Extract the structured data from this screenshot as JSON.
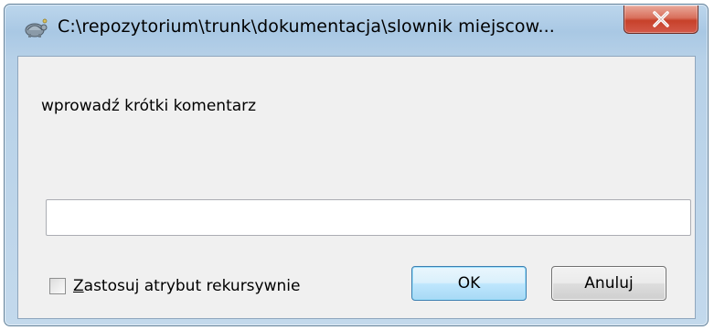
{
  "window": {
    "title": "C:\\repozytorium\\trunk\\dokumentacja\\slownik miejscow...",
    "app_icon": "tortoise-svn-icon",
    "close_icon": "close-icon"
  },
  "dialog": {
    "prompt": "wprowadź krótki komentarz",
    "comment_value": "",
    "recursive_checkbox": {
      "checked": false,
      "mnemonic": "Z",
      "label_rest": "astosuj atrybut rekursywnie"
    },
    "ok_label": "OK",
    "cancel_label": "Anuluj"
  },
  "colors": {
    "close_button": "#c7412a",
    "default_button_border": "#3c7fb1"
  }
}
